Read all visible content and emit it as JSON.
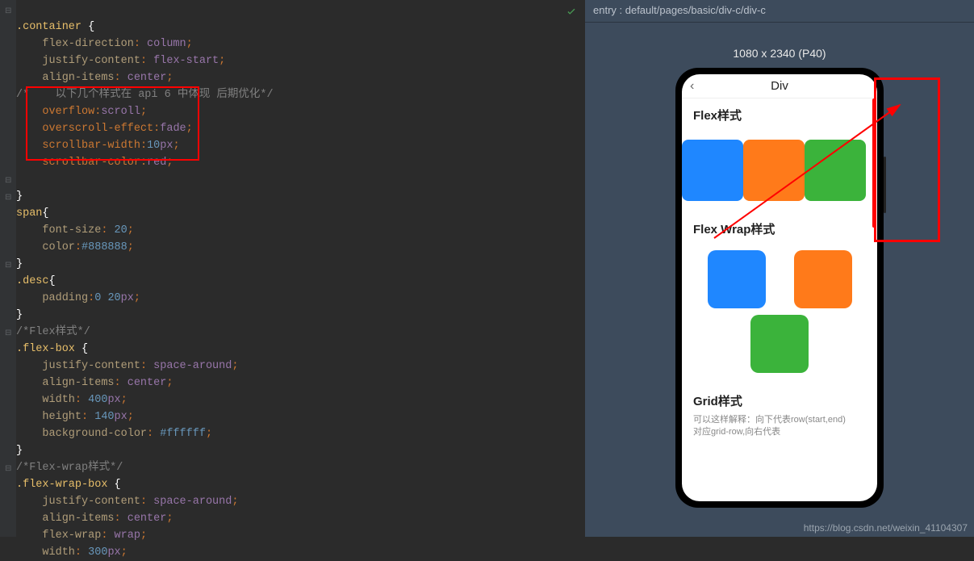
{
  "entry_bar": "entry : default/pages/basic/div-c/div-c",
  "device_dim": "1080 x 2340 (P40)",
  "watermark": "https://blog.csdn.net/weixin_41104307",
  "phone": {
    "nav_title": "Div",
    "sec_flex": "Flex样式",
    "sec_flex_wrap": "Flex Wrap样式",
    "sec_grid": "Grid样式",
    "grid_desc_l1": "可以这样解释：向下代表row(start,end)",
    "grid_desc_l2": "对应grid-row,向右代表"
  },
  "code": {
    "l0_sel": ".container",
    "l1_prop": "flex-direction",
    "l1_val": "column",
    "l2_prop": "justify-content",
    "l2_val": "flex-start",
    "l3_prop": "align-items",
    "l3_val": "center",
    "l4_cmt": "/*    以下几个样式在 api 6 中体现 后期优化*/",
    "l5_prop": "overflow",
    "l5_val": "scroll",
    "l6_prop": "overscroll-effect",
    "l6_val": "fade",
    "l7_prop": "scrollbar-width",
    "l7_num": "10",
    "l7_unit": "px",
    "l8_prop": "scrollbar-color",
    "l8_val": "red",
    "l10_sel": "span",
    "l11_prop": "font-size",
    "l11_num": "20",
    "l12_prop": "color",
    "l12_val": "#888888",
    "l14_sel": ".desc",
    "l15_prop": "padding",
    "l15_v1": "0",
    "l15_v2": "20",
    "l15_unit": "px",
    "l17_cmt": "/*Flex样式*/",
    "l18_sel": ".flex-box",
    "l19_prop": "justify-content",
    "l19_val": "space-around",
    "l20_prop": "align-items",
    "l20_val": "center",
    "l21_prop": "width",
    "l21_num": "400",
    "l21_unit": "px",
    "l22_prop": "height",
    "l22_num": "140",
    "l22_unit": "px",
    "l23_prop": "background-color",
    "l23_val": "#ffffff",
    "l25_cmt": "/*Flex-wrap样式*/",
    "l26_sel": ".flex-wrap-box",
    "l27_prop": "justify-content",
    "l27_val": "space-around",
    "l28_prop": "align-items",
    "l28_val": "center",
    "l29_prop": "flex-wrap",
    "l29_val": "wrap",
    "l30_prop": "width",
    "l30_num": "300",
    "l30_unit": "px"
  }
}
